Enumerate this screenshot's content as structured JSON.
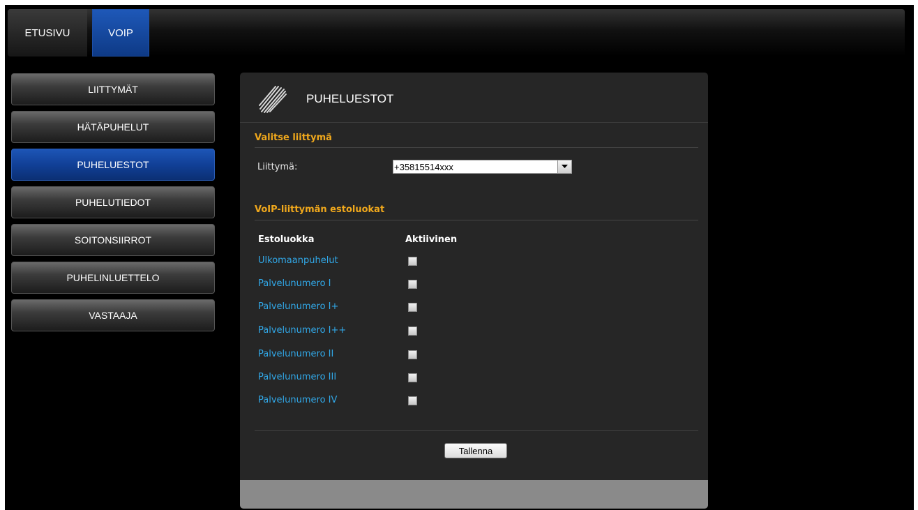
{
  "top_nav": {
    "tabs": [
      {
        "label": "ETUSIVU",
        "active": false
      },
      {
        "label": "VOIP",
        "active": true
      }
    ]
  },
  "sidebar": {
    "items": [
      {
        "label": "LIITTYMÄT",
        "active": false
      },
      {
        "label": "HÄTÄPUHELUT",
        "active": false
      },
      {
        "label": "PUHELUESTOT",
        "active": true
      },
      {
        "label": "PUHELUTIEDOT",
        "active": false
      },
      {
        "label": "SOITONSIIRROT",
        "active": false
      },
      {
        "label": "PUHELINLUETTELO",
        "active": false
      },
      {
        "label": "VASTAAJA",
        "active": false
      }
    ]
  },
  "panel": {
    "title": "PUHELUESTOT",
    "select_section": {
      "title": "Valitse liittymä",
      "field_label": "Liittymä:",
      "selected_value": "+35815514xxx"
    },
    "restrictions_section": {
      "title": "VoIP-liittymän estoluokat",
      "columns": [
        "Estoluokka",
        "Aktiivinen"
      ],
      "rows": [
        {
          "label": "Ulkomaanpuhelut",
          "checked": false
        },
        {
          "label": "Palvelunumero I",
          "checked": false
        },
        {
          "label": "Palvelunumero I+",
          "checked": false
        },
        {
          "label": "Palvelunumero I++",
          "checked": false
        },
        {
          "label": "Palvelunumero II",
          "checked": false
        },
        {
          "label": "Palvelunumero III",
          "checked": false
        },
        {
          "label": "Palvelunumero IV",
          "checked": false
        }
      ]
    },
    "save_label": "Tallenna"
  },
  "colors": {
    "accent_blue": "#114097",
    "section_title": "#f0a81c",
    "link_blue": "#31a8e8"
  }
}
